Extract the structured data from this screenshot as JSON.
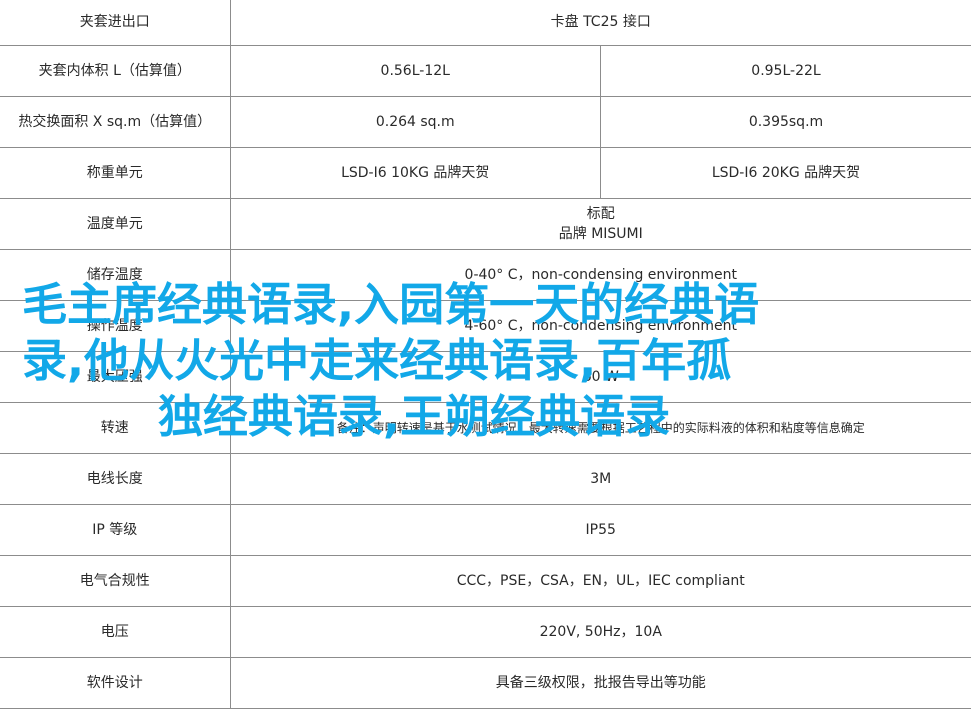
{
  "table": {
    "rows": [
      {
        "label": "夹套进出口",
        "merged": "卡盘 TC25 接口"
      },
      {
        "label": "夹套内体积 L（估算值）",
        "values": [
          "0.56L-12L",
          "0.95L-22L"
        ]
      },
      {
        "label": "热交换面积 X sq.m（估算值）",
        "values": [
          "0.264 sq.m",
          "0.395sq.m"
        ]
      },
      {
        "label": "称重单元",
        "values": [
          "LSD-I6 10KG 品牌天贺",
          "LSD-I6 20KG 品牌天贺"
        ]
      },
      {
        "label": "温度单元",
        "merged_lines": [
          "标配",
          "品牌 MISUMI"
        ]
      },
      {
        "label": "储存温度",
        "merged": "0-40° C，non-condensing environment"
      },
      {
        "label": "操作温度",
        "merged": "4-60° C，non-condensing environment"
      },
      {
        "label": "最大压强",
        "merged": "60 W"
      },
      {
        "label": "转速",
        "merged": "备注：声明转速是基于水测试情况，最大转速需要根据工艺程中的实际料液的体积和粘度等信息确定"
      },
      {
        "label": "电线长度",
        "merged": "3M"
      },
      {
        "label": "IP 等级",
        "merged": "IP55"
      },
      {
        "label": "电气合规性",
        "merged": "CCC，PSE，CSA，EN，UL，IEC compliant"
      },
      {
        "label": "电压",
        "merged": "220V, 50Hz，10A"
      },
      {
        "label": "软件设计",
        "merged": "具备三级权限，批报告导出等功能"
      }
    ]
  },
  "overlay": {
    "line1": "毛主席经典语录,入园第一天的经典语",
    "line2": "录,他从火光中走来经典语录,百年孤",
    "line3": "独经典语录,王朔经典语录"
  }
}
